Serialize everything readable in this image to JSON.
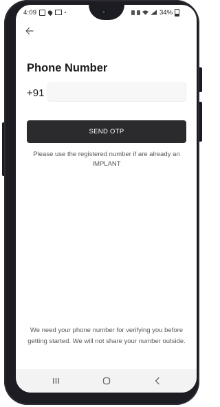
{
  "status_bar": {
    "time": "4:09",
    "battery": "34%"
  },
  "header": {
    "back_icon": "arrow-left-icon"
  },
  "form": {
    "title": "Phone Number",
    "country_code": "+91",
    "phone_value": "",
    "phone_placeholder": "",
    "send_button_label": "SEND OTP",
    "hint": "Please use the registered number if are already an IMPLANT"
  },
  "footer": {
    "note": "We need your phone number for verifying you before getting started. We will not share your number outside."
  },
  "nav_bar": {
    "recents_icon": "recents-icon",
    "home_icon": "home-icon",
    "back_icon": "back-triangle-icon"
  },
  "colors": {
    "button_bg": "#2b2b2d",
    "button_text": "#ffffff",
    "input_bg": "#f7f7f7",
    "text_primary": "#1a1a1a",
    "text_secondary": "#555555",
    "phone_frame": "#1c1c22"
  }
}
